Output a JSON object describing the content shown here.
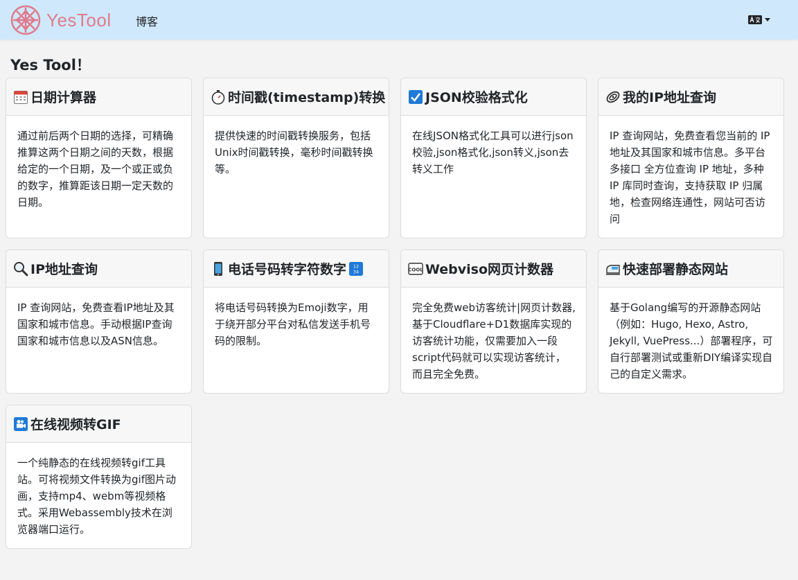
{
  "nav": {
    "brand": "YesTool",
    "link_blog": "博客",
    "lang_icon": "language-icon"
  },
  "main": {
    "heading": "Yes Tool！"
  },
  "cards": [
    {
      "icon": "calendar-icon",
      "title": "日期计算器",
      "desc": "通过前后两个日期的选择，可精确推算这两个日期之间的天数，根据给定的一个日期，及一个或正或负的数字，推算距该日期一定天数的日期。"
    },
    {
      "icon": "stopwatch-icon",
      "title": "时间戳(timestamp)转换",
      "desc": "提供快速的时间戳转换服务，包括Unix时间戳转换，毫秒时间戳转换等。"
    },
    {
      "icon": "check-icon",
      "title": "JSON校验格式化",
      "desc": "在线JSON格式化工具可以进行json校验,json格式化,json转义,json去转义工作"
    },
    {
      "icon": "network-icon",
      "title": "我的IP地址查询",
      "desc": "IP 查询网站，免费查看您当前的 IP 地址及其国家和城市信息。多平台 多接口 全方位查询 IP 地址，多种 IP 库同时查询，支持获取 IP 归属地，检查网络连通性，网站可否访问"
    },
    {
      "icon": "magnifier-icon",
      "title": "IP地址查询",
      "desc": "IP 查询网站，免费查看IP地址及其国家和城市信息。手动根据IP查询国家和城市信息以及ASN信息。"
    },
    {
      "icon": "phone-icon",
      "title": "电话号码转字符数字",
      "title_suffix_icon": "numbers-icon",
      "desc": "将电话号码转换为Emoji数字，用于绕开部分平台对私信发送手机号码的限制。"
    },
    {
      "icon": "cool-icon",
      "title": "Webviso网页计数器",
      "desc": "完全免费web访客统计|网页计数器,基于Cloudflare+D1数据库实现的访客统计功能，仅需要加入一段script代码就可以实现访客统计，而且完全免费。"
    },
    {
      "icon": "train-icon",
      "title": "快速部署静态网站",
      "desc": "基于Golang编写的开源静态网站（例如：Hugo, Hexo, Astro, Jekyll, VuePress...）部署程序，可自行部署测试或重新DIY编译实现自己的自定义需求。"
    },
    {
      "icon": "movie-camera-icon",
      "title": "在线视频转GIF",
      "desc": "一个纯静态的在线视频转gif工具站。可将视频文件转换为gif图片动画，支持mp4、webm等视频格式。采用Webassembly技术在浏览器端口运行。"
    }
  ],
  "colors": {
    "navbar_bg": "#cfe8fb",
    "brand": "#e07a8c",
    "page_bg": "#f3f3f3",
    "card_header_bg": "#f7f7f7"
  }
}
